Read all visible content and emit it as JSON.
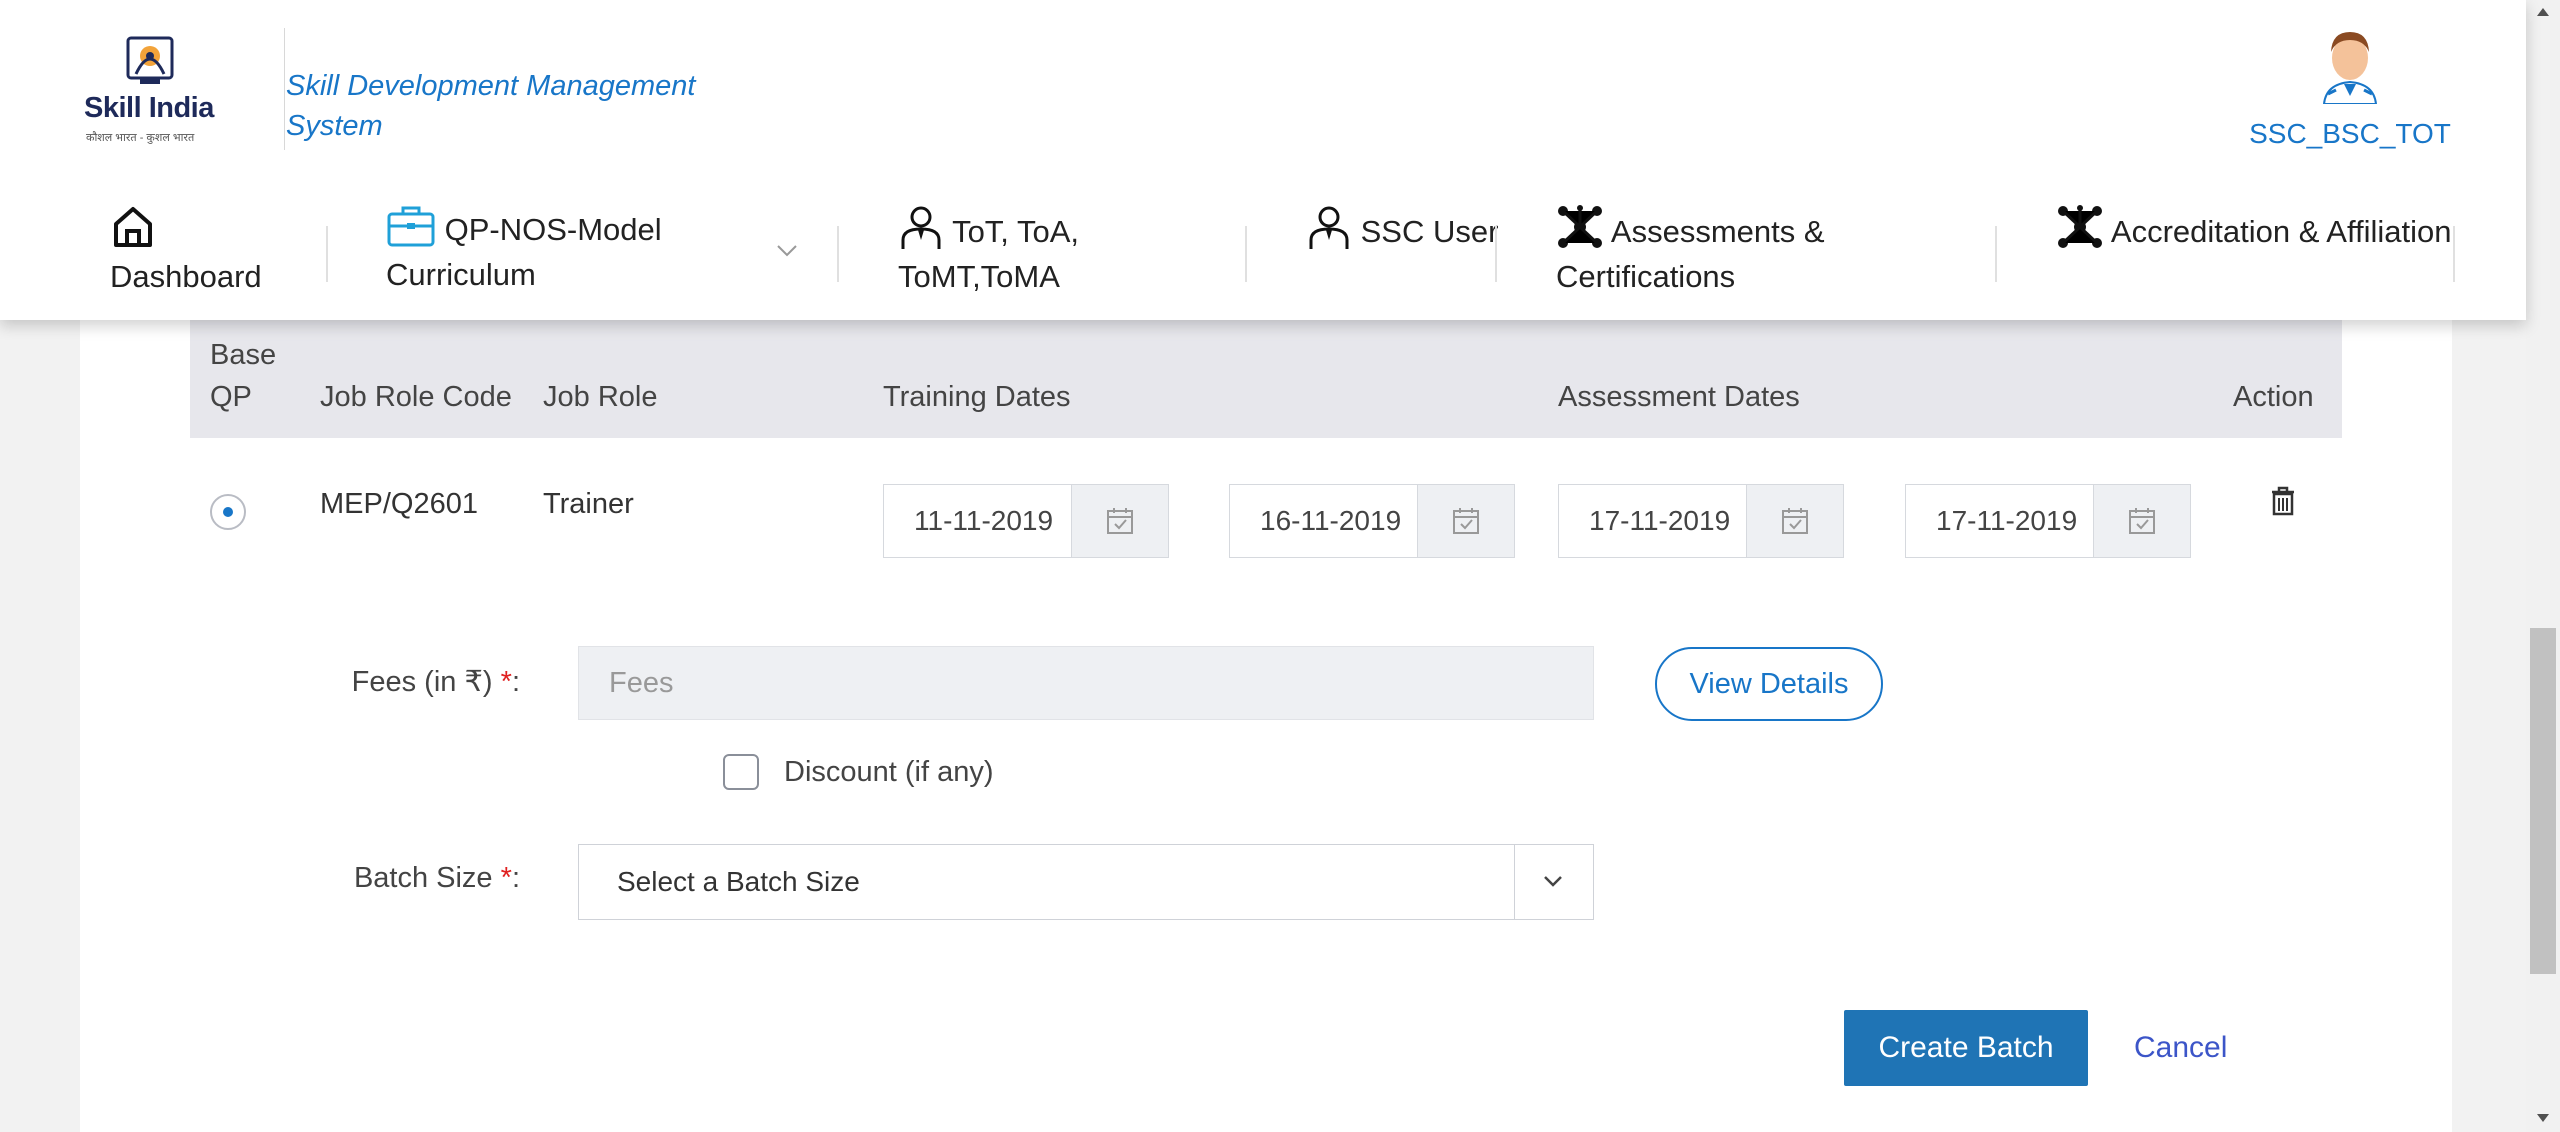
{
  "header": {
    "brand": "Skill India",
    "brand_tagline": "कौशल भारत - कुशल भारत",
    "app_title": "Skill Development Management System",
    "user_name": "SSC_BSC_TOT"
  },
  "nav": {
    "dashboard": "Dashboard",
    "qp_nos": "QP-NOS-Model Curriculum",
    "tot": "ToT, ToA, ToMT,ToMA",
    "ssc_user": "SSC User",
    "assessments": "Assessments & Certifications",
    "accreditation": "Accreditation & Affiliation"
  },
  "table": {
    "headers": {
      "base_qp": "Base QP",
      "job_role_code": "Job Role Code",
      "job_role": "Job Role",
      "training_dates": "Training Dates",
      "assessment_dates": "Assessment Dates",
      "action": "Action"
    },
    "row": {
      "selected": true,
      "job_role_code": "MEP/Q2601",
      "job_role": "Trainer",
      "training_start": "11-11-2019",
      "training_end": "16-11-2019",
      "assessment_start": "17-11-2019",
      "assessment_end": "17-11-2019"
    }
  },
  "form": {
    "fees_label": "Fees (in ₹)",
    "fees_placeholder": "Fees",
    "view_details": "View Details",
    "discount_label": "Discount (if any)",
    "discount_checked": false,
    "batch_size_label": "Batch Size",
    "batch_size_selected": "Select a Batch Size",
    "required_marker": "*",
    "colon": ":",
    "create_batch": "Create Batch",
    "cancel": "Cancel"
  },
  "icons": {
    "home": "home-icon",
    "briefcase": "briefcase-icon",
    "trainer": "user-tie-icon",
    "network": "network-icon",
    "calendar": "calendar-icon",
    "trash": "trash-icon",
    "chevron": "chevron-down-icon"
  },
  "colors": {
    "accent": "#1876c8",
    "primary_button": "#1f74b5",
    "required": "#e02020",
    "table_header_bg": "#e7e7ec"
  }
}
